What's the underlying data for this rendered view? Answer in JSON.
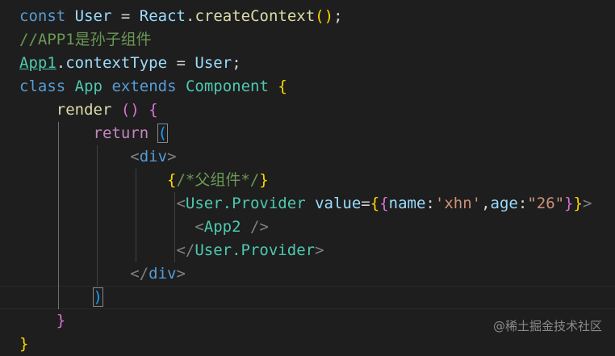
{
  "lines": {
    "l0": [
      "const",
      "User",
      "=",
      "React",
      ".",
      "createContext",
      "(",
      ")",
      ";"
    ],
    "l1": [
      "//APP1是孙子组件"
    ],
    "l2": [
      "App1",
      ".",
      "contextType",
      "=",
      "User",
      ";"
    ],
    "l3": [
      "class",
      "App",
      "extends",
      "Component",
      "{"
    ],
    "l4": [
      "render",
      "(",
      ")",
      "{"
    ],
    "l5": [
      "return",
      "("
    ],
    "l6": [
      "<",
      "div",
      ">"
    ],
    "l7": [
      "{",
      "/*父组件*/",
      "}"
    ],
    "l8": [
      "<",
      "User.Provider",
      "value",
      "=",
      "{",
      "{",
      "name",
      ":",
      "'xhn'",
      ",",
      "age",
      ":",
      "\"26\"",
      "}",
      "}",
      ">"
    ],
    "l9": [
      "<",
      "App2",
      "/>"
    ],
    "l10": [
      "</",
      "User.Provider",
      ">"
    ],
    "l11": [
      "</",
      "div",
      ">"
    ],
    "l12": [
      ")"
    ],
    "l13": [
      "}"
    ],
    "l14": [
      "}"
    ]
  },
  "watermark": "@稀土掘金技术社区"
}
